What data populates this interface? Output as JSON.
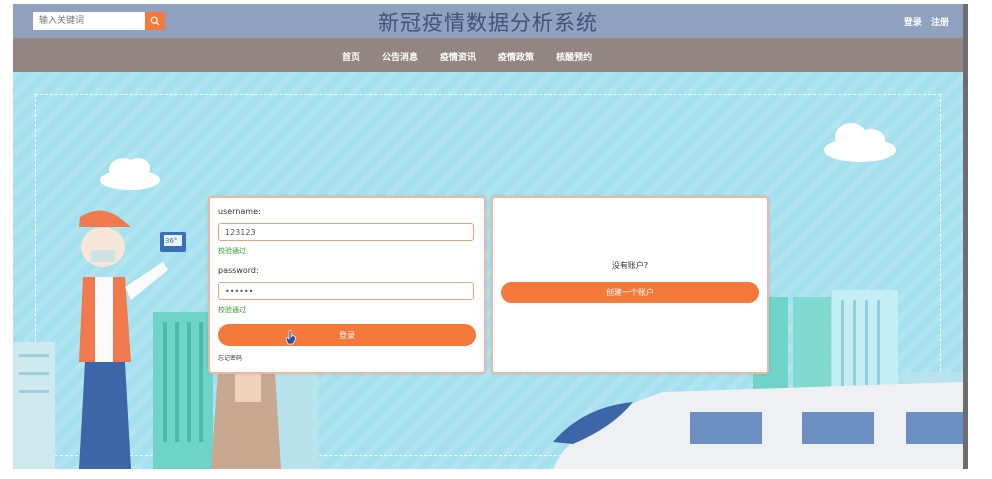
{
  "header": {
    "title": "新冠疫情数据分析系统",
    "search_placeholder": "输入关键词",
    "login_link": "登录",
    "register_link": "注册"
  },
  "nav": {
    "items": [
      "首页",
      "公告消息",
      "疫情资讯",
      "疫情政策",
      "核酸预约"
    ]
  },
  "login": {
    "username_label": "username:",
    "username_value": "123123",
    "username_status": "校验通过",
    "password_label": "password:",
    "password_value": "••••••",
    "password_status": "校验通过",
    "submit_label": "登录",
    "forgot_label": "忘记密码"
  },
  "register": {
    "prompt": "没有账户?",
    "create_label": "创建一个账户"
  },
  "hero": {
    "thermometer_reading": "36°"
  },
  "colors": {
    "topbar": "#8fa1bf",
    "navbar": "#938581",
    "accent": "#f4793b",
    "title": "#3f5478",
    "success": "#2e9e2e",
    "sky": "#a5e0ee"
  }
}
